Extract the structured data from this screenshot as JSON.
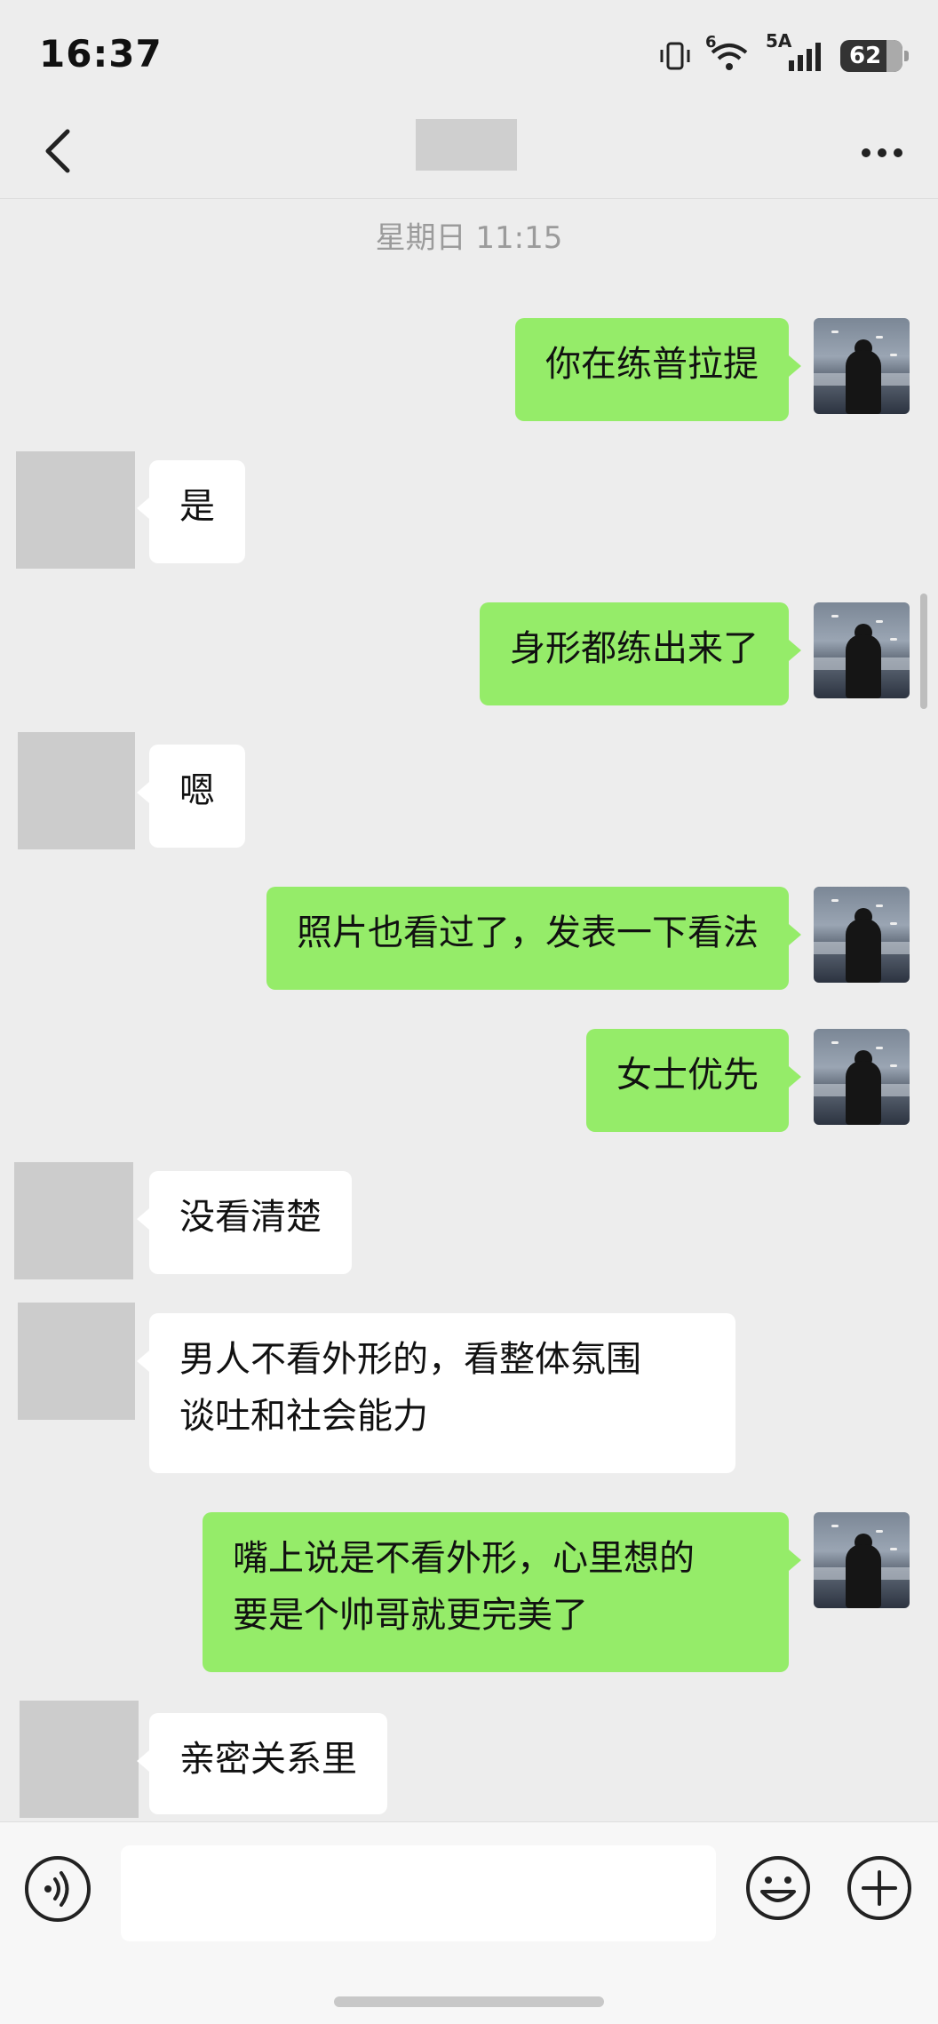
{
  "status_bar": {
    "time": "16:37",
    "network_label": "5A",
    "signal_badge": "6",
    "battery_level": "62"
  },
  "nav": {
    "contact_name": ""
  },
  "chat": {
    "timestamp": "星期日 11:15",
    "messages": [
      {
        "side": "out",
        "text": "你在练普拉提"
      },
      {
        "side": "in",
        "text": "是"
      },
      {
        "side": "out",
        "text": "身形都练出来了"
      },
      {
        "side": "in",
        "text": "嗯"
      },
      {
        "side": "out",
        "text": "照片也看过了，发表一下看法"
      },
      {
        "side": "out",
        "text": "女士优先"
      },
      {
        "side": "in",
        "text": "没看清楚"
      },
      {
        "side": "in",
        "text": "男人不看外形的，看整体氛围\n谈吐和社会能力"
      },
      {
        "side": "out",
        "text": "嘴上说是不看外形，心里想的\n要是个帅哥就更完美了"
      },
      {
        "side": "in",
        "text": "亲密关系里"
      }
    ]
  },
  "input_bar": {
    "message_value": "",
    "icons": [
      "voice-icon",
      "emoji-icon",
      "plus-icon"
    ]
  },
  "colors": {
    "outgoing_bubble": "#95ec69",
    "incoming_bubble": "#ffffff",
    "background": "#ededed"
  }
}
